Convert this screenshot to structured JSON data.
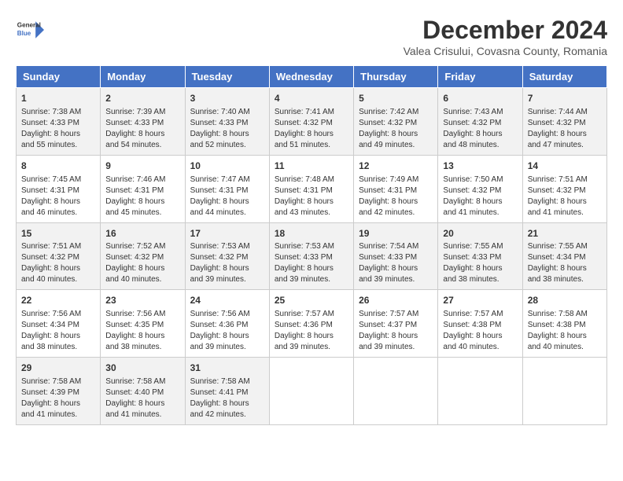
{
  "header": {
    "logo_line1": "General",
    "logo_line2": "Blue",
    "main_title": "December 2024",
    "sub_title": "Valea Crisului, Covasna County, Romania"
  },
  "calendar": {
    "columns": [
      "Sunday",
      "Monday",
      "Tuesday",
      "Wednesday",
      "Thursday",
      "Friday",
      "Saturday"
    ],
    "weeks": [
      [
        {
          "day": 1,
          "sunrise": "7:38 AM",
          "sunset": "4:33 PM",
          "daylight": "8 hours and 55 minutes."
        },
        {
          "day": 2,
          "sunrise": "7:39 AM",
          "sunset": "4:33 PM",
          "daylight": "8 hours and 54 minutes."
        },
        {
          "day": 3,
          "sunrise": "7:40 AM",
          "sunset": "4:33 PM",
          "daylight": "8 hours and 52 minutes."
        },
        {
          "day": 4,
          "sunrise": "7:41 AM",
          "sunset": "4:32 PM",
          "daylight": "8 hours and 51 minutes."
        },
        {
          "day": 5,
          "sunrise": "7:42 AM",
          "sunset": "4:32 PM",
          "daylight": "8 hours and 49 minutes."
        },
        {
          "day": 6,
          "sunrise": "7:43 AM",
          "sunset": "4:32 PM",
          "daylight": "8 hours and 48 minutes."
        },
        {
          "day": 7,
          "sunrise": "7:44 AM",
          "sunset": "4:32 PM",
          "daylight": "8 hours and 47 minutes."
        }
      ],
      [
        {
          "day": 8,
          "sunrise": "7:45 AM",
          "sunset": "4:31 PM",
          "daylight": "8 hours and 46 minutes."
        },
        {
          "day": 9,
          "sunrise": "7:46 AM",
          "sunset": "4:31 PM",
          "daylight": "8 hours and 45 minutes."
        },
        {
          "day": 10,
          "sunrise": "7:47 AM",
          "sunset": "4:31 PM",
          "daylight": "8 hours and 44 minutes."
        },
        {
          "day": 11,
          "sunrise": "7:48 AM",
          "sunset": "4:31 PM",
          "daylight": "8 hours and 43 minutes."
        },
        {
          "day": 12,
          "sunrise": "7:49 AM",
          "sunset": "4:31 PM",
          "daylight": "8 hours and 42 minutes."
        },
        {
          "day": 13,
          "sunrise": "7:50 AM",
          "sunset": "4:32 PM",
          "daylight": "8 hours and 41 minutes."
        },
        {
          "day": 14,
          "sunrise": "7:51 AM",
          "sunset": "4:32 PM",
          "daylight": "8 hours and 41 minutes."
        }
      ],
      [
        {
          "day": 15,
          "sunrise": "7:51 AM",
          "sunset": "4:32 PM",
          "daylight": "8 hours and 40 minutes."
        },
        {
          "day": 16,
          "sunrise": "7:52 AM",
          "sunset": "4:32 PM",
          "daylight": "8 hours and 40 minutes."
        },
        {
          "day": 17,
          "sunrise": "7:53 AM",
          "sunset": "4:32 PM",
          "daylight": "8 hours and 39 minutes."
        },
        {
          "day": 18,
          "sunrise": "7:53 AM",
          "sunset": "4:33 PM",
          "daylight": "8 hours and 39 minutes."
        },
        {
          "day": 19,
          "sunrise": "7:54 AM",
          "sunset": "4:33 PM",
          "daylight": "8 hours and 39 minutes."
        },
        {
          "day": 20,
          "sunrise": "7:55 AM",
          "sunset": "4:33 PM",
          "daylight": "8 hours and 38 minutes."
        },
        {
          "day": 21,
          "sunrise": "7:55 AM",
          "sunset": "4:34 PM",
          "daylight": "8 hours and 38 minutes."
        }
      ],
      [
        {
          "day": 22,
          "sunrise": "7:56 AM",
          "sunset": "4:34 PM",
          "daylight": "8 hours and 38 minutes."
        },
        {
          "day": 23,
          "sunrise": "7:56 AM",
          "sunset": "4:35 PM",
          "daylight": "8 hours and 38 minutes."
        },
        {
          "day": 24,
          "sunrise": "7:56 AM",
          "sunset": "4:36 PM",
          "daylight": "8 hours and 39 minutes."
        },
        {
          "day": 25,
          "sunrise": "7:57 AM",
          "sunset": "4:36 PM",
          "daylight": "8 hours and 39 minutes."
        },
        {
          "day": 26,
          "sunrise": "7:57 AM",
          "sunset": "4:37 PM",
          "daylight": "8 hours and 39 minutes."
        },
        {
          "day": 27,
          "sunrise": "7:57 AM",
          "sunset": "4:38 PM",
          "daylight": "8 hours and 40 minutes."
        },
        {
          "day": 28,
          "sunrise": "7:58 AM",
          "sunset": "4:38 PM",
          "daylight": "8 hours and 40 minutes."
        }
      ],
      [
        {
          "day": 29,
          "sunrise": "7:58 AM",
          "sunset": "4:39 PM",
          "daylight": "8 hours and 41 minutes."
        },
        {
          "day": 30,
          "sunrise": "7:58 AM",
          "sunset": "4:40 PM",
          "daylight": "8 hours and 41 minutes."
        },
        {
          "day": 31,
          "sunrise": "7:58 AM",
          "sunset": "4:41 PM",
          "daylight": "8 hours and 42 minutes."
        },
        null,
        null,
        null,
        null
      ]
    ]
  }
}
